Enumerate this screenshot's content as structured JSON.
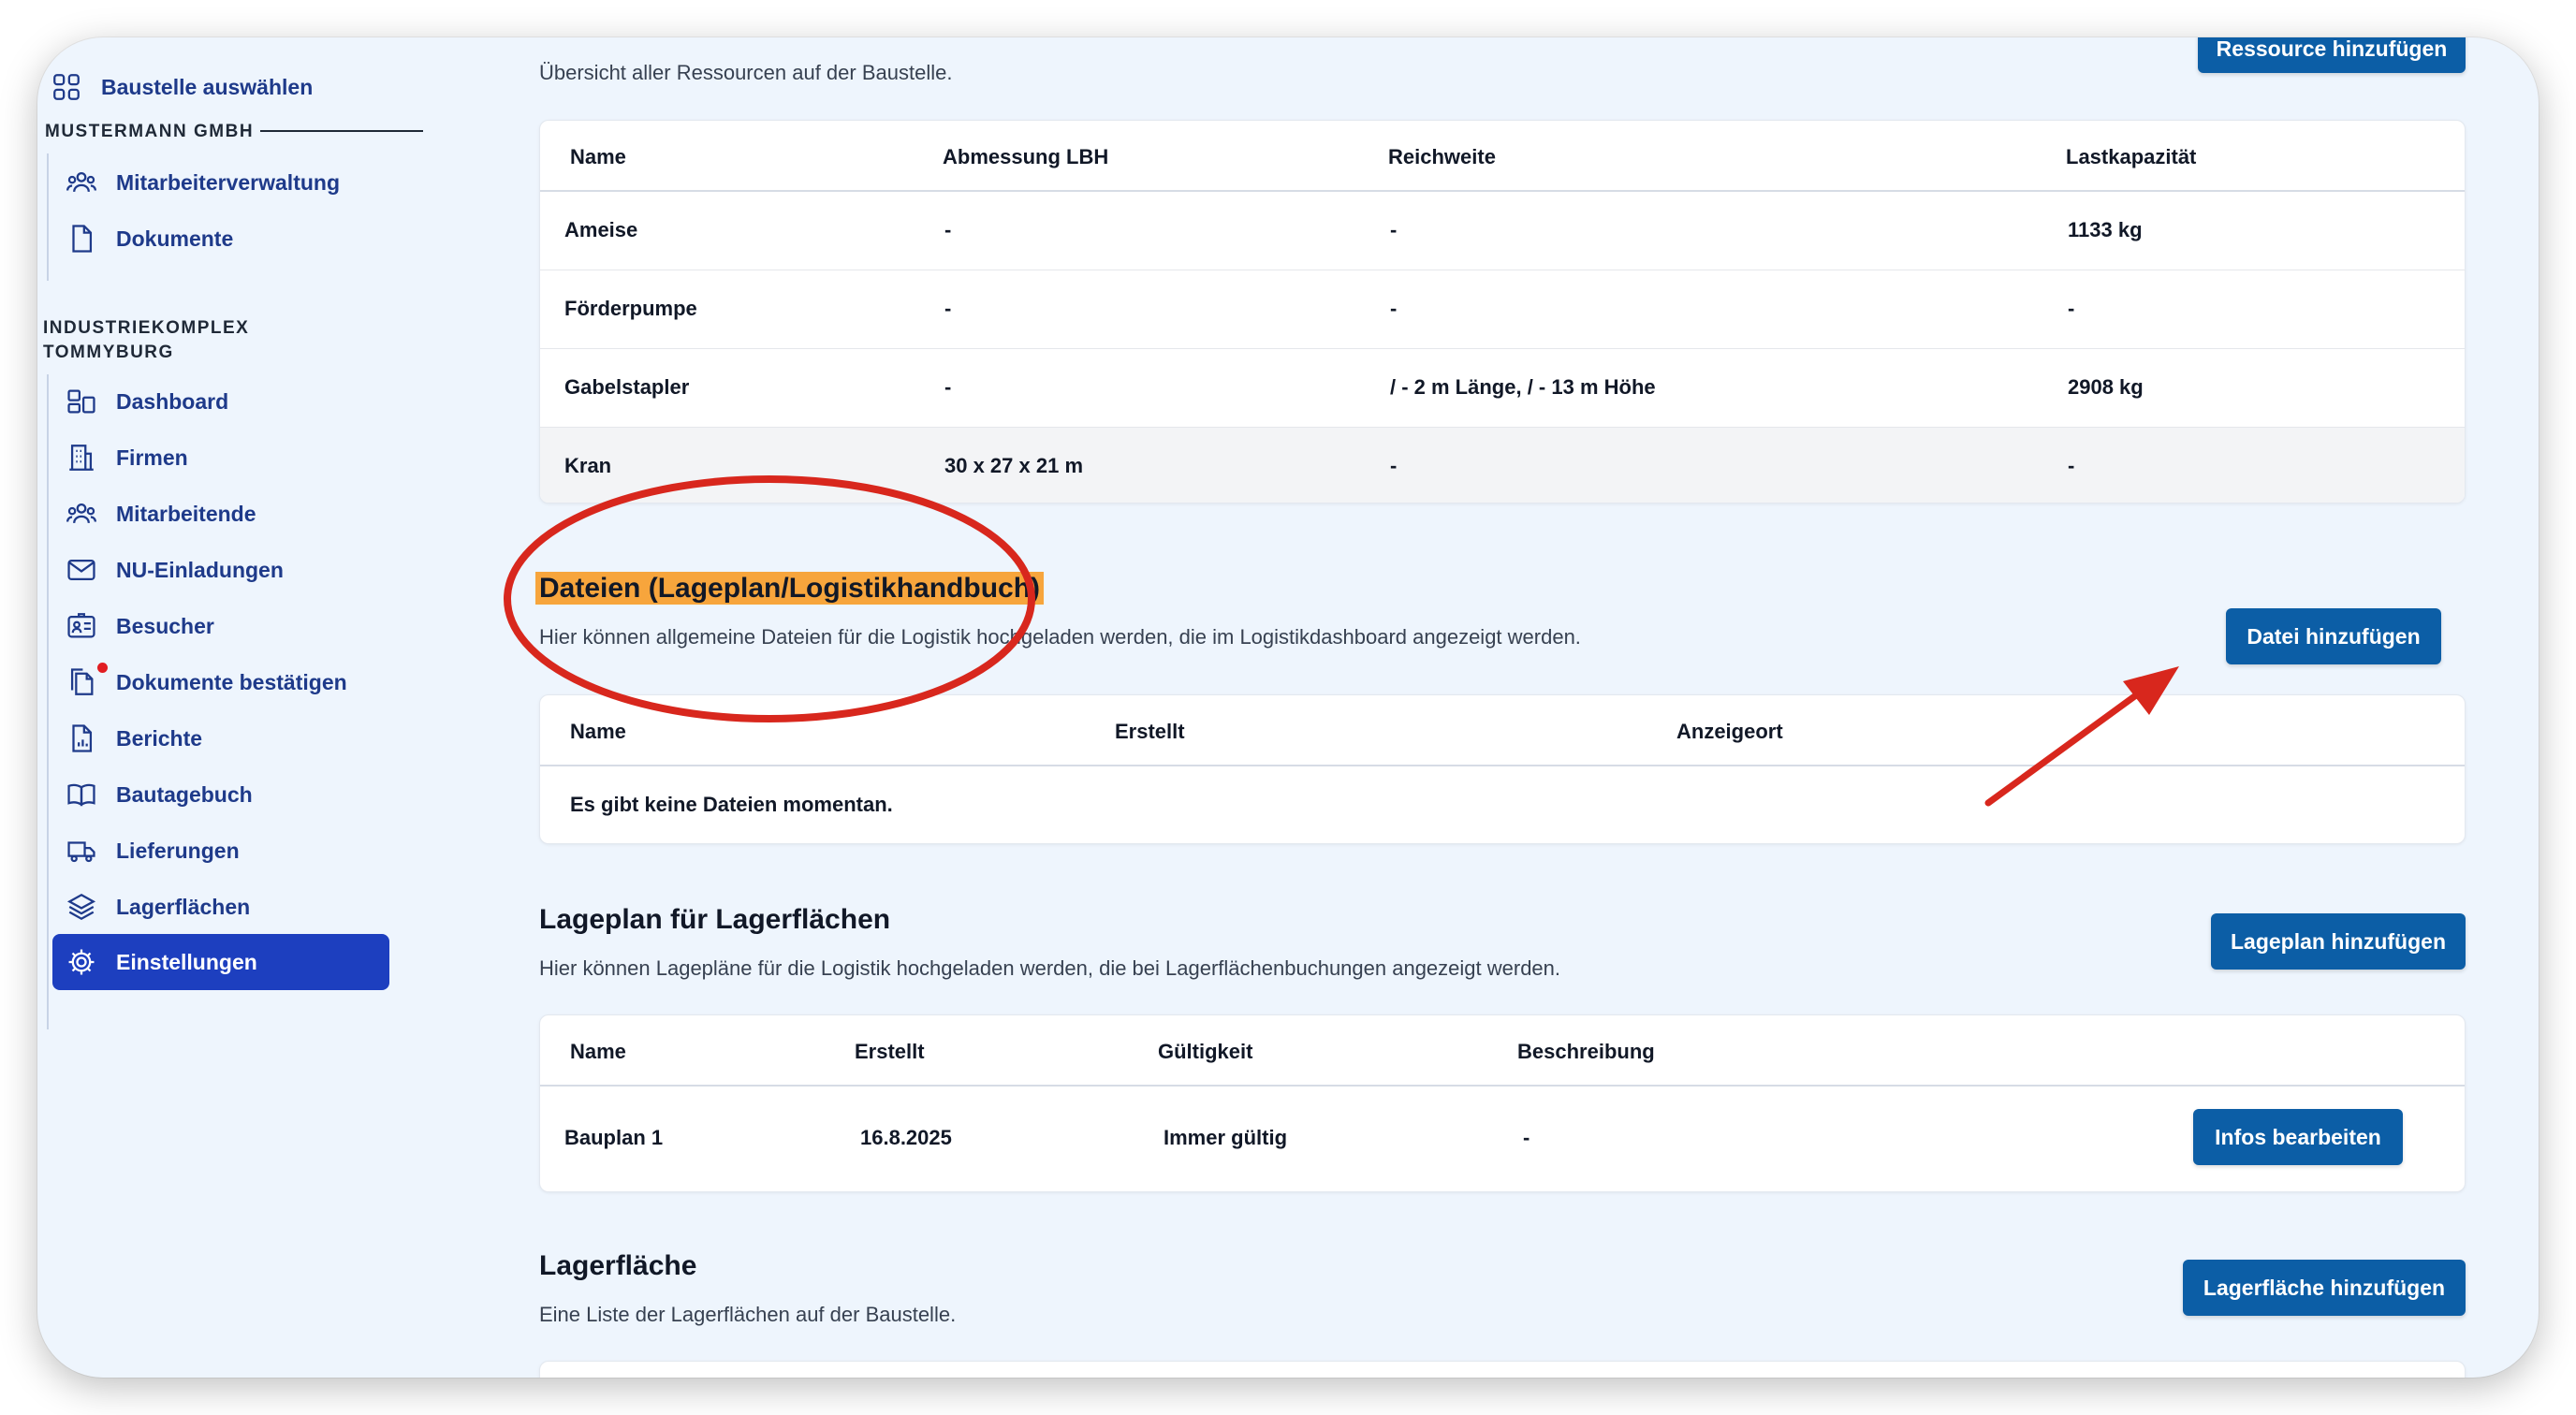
{
  "sidebar": {
    "select_site": "Baustelle auswählen",
    "group1": {
      "title": "MUSTERMANN GMBH",
      "items": [
        "Mitarbeiterverwaltung",
        "Dokumente"
      ]
    },
    "group2": {
      "title_line1": "INDUSTRIEKOMPLEX",
      "title_line2": "TOMMYBURG",
      "items": [
        "Dashboard",
        "Firmen",
        "Mitarbeitende",
        "NU-Einladungen",
        "Besucher",
        "Dokumente bestätigen",
        "Berichte",
        "Bautagebuch",
        "Lieferungen",
        "Lagerflächen",
        "Einstellungen"
      ]
    }
  },
  "resources": {
    "description": "Übersicht aller Ressourcen auf der Baustelle.",
    "add_button": "Ressource hinzufügen",
    "headers": [
      "Name",
      "Abmessung LBH",
      "Reichweite",
      "Lastkapazität"
    ],
    "rows": [
      [
        "Ameise",
        "-",
        "-",
        "1133 kg"
      ],
      [
        "Förderpumpe",
        "-",
        "-",
        "-"
      ],
      [
        "Gabelstapler",
        "-",
        "/ - 2 m Länge, / - 13 m Höhe",
        "2908 kg"
      ],
      [
        "Kran",
        "30 x 27 x 21 m",
        "-",
        "-"
      ]
    ]
  },
  "files": {
    "title": "Dateien (Lageplan/Logistikhandbuch)",
    "description": "Hier können allgemeine Dateien für die Logistik hochgeladen werden, die im Logistikdashboard angezeigt werden.",
    "add_button": "Datei hinzufügen",
    "headers": [
      "Name",
      "Erstellt",
      "Anzeigeort"
    ],
    "empty": "Es gibt keine Dateien momentan."
  },
  "siteplan": {
    "title": "Lageplan für Lagerflächen",
    "description": "Hier können Lagepläne für die Logistik hochgeladen werden, die bei Lagerflächenbuchungen angezeigt werden.",
    "add_button": "Lageplan hinzufügen",
    "headers": [
      "Name",
      "Erstellt",
      "Gültigkeit",
      "Beschreibung"
    ],
    "rows": [
      {
        "name": "Bauplan 1",
        "created": "16.8.2025",
        "validity": "Immer gültig",
        "description": "-",
        "action": "Infos bearbeiten"
      }
    ]
  },
  "storage": {
    "title": "Lagerfläche",
    "description": "Eine Liste der Lagerflächen auf der Baustelle.",
    "add_button": "Lagerfläche hinzufügen"
  },
  "colors": {
    "accent": "#0c5ea6",
    "nav_active": "#1d3fbf",
    "highlight": "#f7a53c",
    "annotation_red": "#d8271d"
  }
}
